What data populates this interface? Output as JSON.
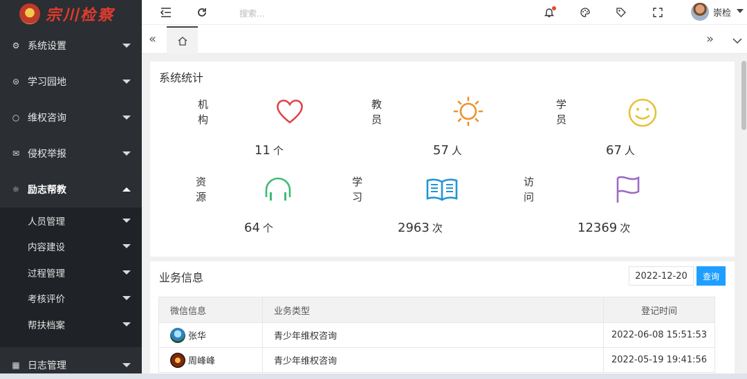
{
  "brand": {
    "title": "宗川检察"
  },
  "sidebar": {
    "items": [
      {
        "label": "系统设置",
        "icon": "gear-icon"
      },
      {
        "label": "学习园地",
        "icon": "book-icon"
      },
      {
        "label": "维权咨询",
        "icon": "circle-icon"
      },
      {
        "label": "侵权举报",
        "icon": "mail-icon"
      },
      {
        "label": "励志帮教",
        "icon": "sun-icon"
      }
    ],
    "subitems": [
      "人员管理",
      "内容建设",
      "过程管理",
      "考核评价",
      "帮扶档案"
    ],
    "log_item": {
      "label": "日志管理",
      "icon": "grid-icon"
    }
  },
  "topbar": {
    "search_placeholder": "搜索...",
    "user_name": "崇检"
  },
  "stats_card": {
    "title": "系统统计",
    "stats": [
      {
        "label": "机构",
        "value": "11",
        "unit": "个",
        "icon": "heart-icon",
        "color": "#e0424a"
      },
      {
        "label": "教员",
        "value": "57",
        "unit": "人",
        "icon": "sun-icon",
        "color": "#f0902c"
      },
      {
        "label": "学员",
        "value": "67",
        "unit": "人",
        "icon": "smile-icon",
        "color": "#e6c23a"
      },
      {
        "label": "资源",
        "value": "64",
        "unit": "个",
        "icon": "headphones-icon",
        "color": "#3fba75"
      },
      {
        "label": "学习",
        "value": "2963",
        "unit": "次",
        "icon": "open-book-icon",
        "color": "#2196d3"
      },
      {
        "label": "访问",
        "value": "12369",
        "unit": "次",
        "icon": "flag-icon",
        "color": "#9b6bc4"
      }
    ]
  },
  "biz_card": {
    "title": "业务信息",
    "date_value": "2022-12-20",
    "query_label": "查询",
    "columns": [
      "微信信息",
      "业务类型",
      "登记时间"
    ],
    "rows": [
      {
        "name": "张华",
        "type": "青少年维权咨询",
        "time": "2022-06-08 15:51:53"
      },
      {
        "name": "周峰峰",
        "type": "青少年维权咨询",
        "time": "2022-05-19 19:41:56"
      }
    ]
  }
}
